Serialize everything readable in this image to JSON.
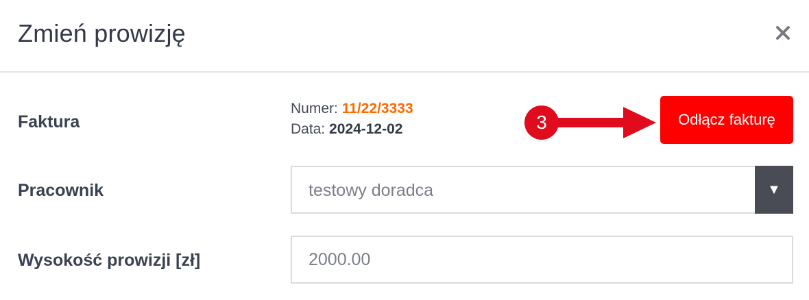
{
  "dialog": {
    "title": "Zmień prowizję",
    "close_icon": "close-icon"
  },
  "invoice": {
    "label": "Faktura",
    "number_label": "Numer:",
    "number_value": "11/22/3333",
    "date_label": "Data:",
    "date_value": "2024-12-02",
    "detach_button": "Odłącz fakturę",
    "step_badge": "3"
  },
  "employee": {
    "label": "Pracownik",
    "selected": "testowy doradca"
  },
  "commission": {
    "label": "Wysokość prowizji [zł]",
    "value": "2000.00"
  },
  "colors": {
    "detach_button": "#ff0000",
    "badge": "#e00b1c",
    "invoice_number": "#ff6a00",
    "select_caret_bg": "#4a4c55"
  }
}
